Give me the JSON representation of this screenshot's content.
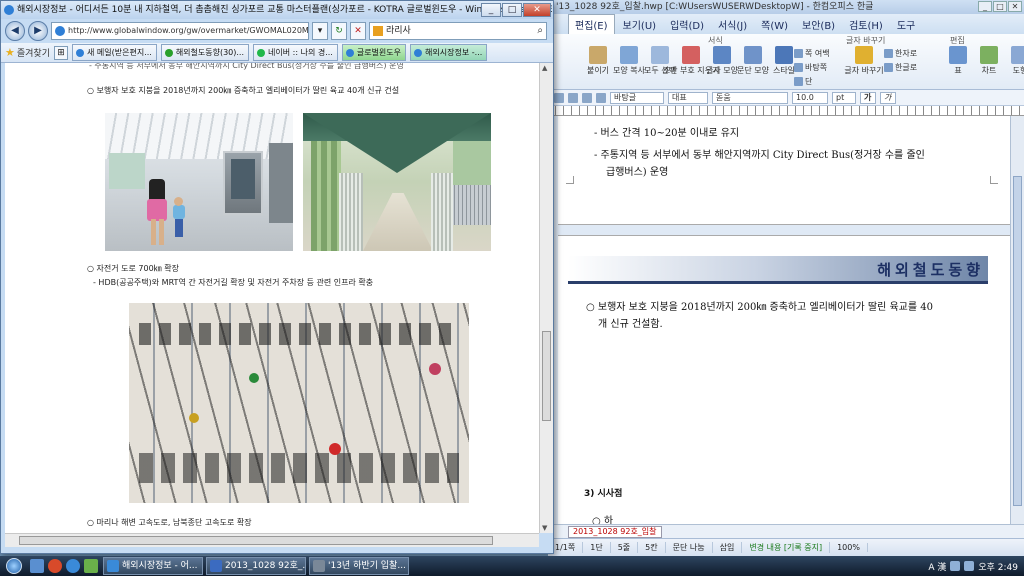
{
  "hwp": {
    "title": "'13_1028 92호_입찰.hwp [C:WUsersWUSERWDesktopW] - 한컴오피스 한글",
    "menu": [
      "편집(E)",
      "보기(U)",
      "입력(D)",
      "서식(J)",
      "쪽(W)",
      "보안(B)",
      "검토(H)",
      "도구"
    ],
    "ribbon": {
      "group_labels": [
        "서식",
        "글자 바꾸기",
        "편집"
      ],
      "buttons": [
        "붙이기",
        "모양 복사",
        "모두 선택",
        "조판 부호 지우기",
        "글자 모양",
        "문단 모양",
        "스타일",
        "글자 바꾸기",
        "표",
        "차트",
        "도형"
      ],
      "small": [
        "쪽 여백",
        "바탕쪽",
        "단",
        "한자로",
        "한글로"
      ]
    },
    "toolbar": {
      "style": "바탕글",
      "font_face": "대표",
      "font": "돋움",
      "size": "10.0",
      "unit": "pt"
    },
    "doc": {
      "line1": "- 버스 간격 10~20분 이내로 유지",
      "line2": "- 주통지역 등 서부에서 동부 해안지역까지 City Direct Bus(정거장 수를 줄인",
      "line3": "급행버스) 운영",
      "heading": "해외철도동향",
      "bullet": "○ 보행자 보호 지붕을 2018년까지 200㎞ 증축하고 엘리베이터가 딸린 육교를 40",
      "bullet_cont": "개 신규 건설함.",
      "section": "3) 시사점",
      "item": "○ 하"
    },
    "tab_label": "2013_1028 92호_입찰",
    "status": [
      "1/1쪽",
      "1단",
      "5줄",
      "5칸",
      "문단 나눔",
      "삽입",
      "변경 내용 [기록 중지]"
    ],
    "zoom": "100%"
  },
  "browser": {
    "title": "해외시장정보 - 어디서든 10분 내 지하철역, 더 촘촘해진 싱가포르 교통 마스터플랜(싱가포르 - KOTRA 글로벌윈도우 - Windows Internet Explorer",
    "url": "http://www.globalwindow.org/gw/overmarket/GWOMAL020M.html",
    "search_text": "라리사",
    "favorites_label": "즐겨찾기",
    "tabs": [
      "새 메일(받은편지...",
      "해외철도동향(30)...",
      "네이버 :: 나의 경...",
      "글로벌윈도우",
      "해외시장정보 -..."
    ],
    "content": {
      "top_cut": "- 주통지역 등 서부에서 동부 해안지역까지 City Direct Bus(정거장 수를 줄인 급행버스) 운영",
      "bullet1": "○ 보행자 보호 지붕을 2018년까지 200㎞ 증축하고 엘리베이터가 딸린 육교 40개 신규 건설",
      "bullet2": "○ 자전거 도로 700㎞ 확장",
      "bullet2_sub": "- HDB(공공주택)와 MRT역 간 자전거길 확장 및 자전거 주차장 등 관련 인프라 확충",
      "bullet3": "○ 마리나 해변 고속도로, 남북종단 고속도로 확장"
    }
  },
  "taskbar": {
    "tasks": [
      "해외시장정보 - 어...",
      "2013_1028 92호_...",
      "'13년 하반기 입찰..."
    ],
    "tray_text": "A 漢",
    "clock": "오후 2:49"
  },
  "colors": {
    "heading_bar": "#2a3e6a",
    "ie_title": "#bcd3ee",
    "taskbar": "#1b2b40"
  }
}
